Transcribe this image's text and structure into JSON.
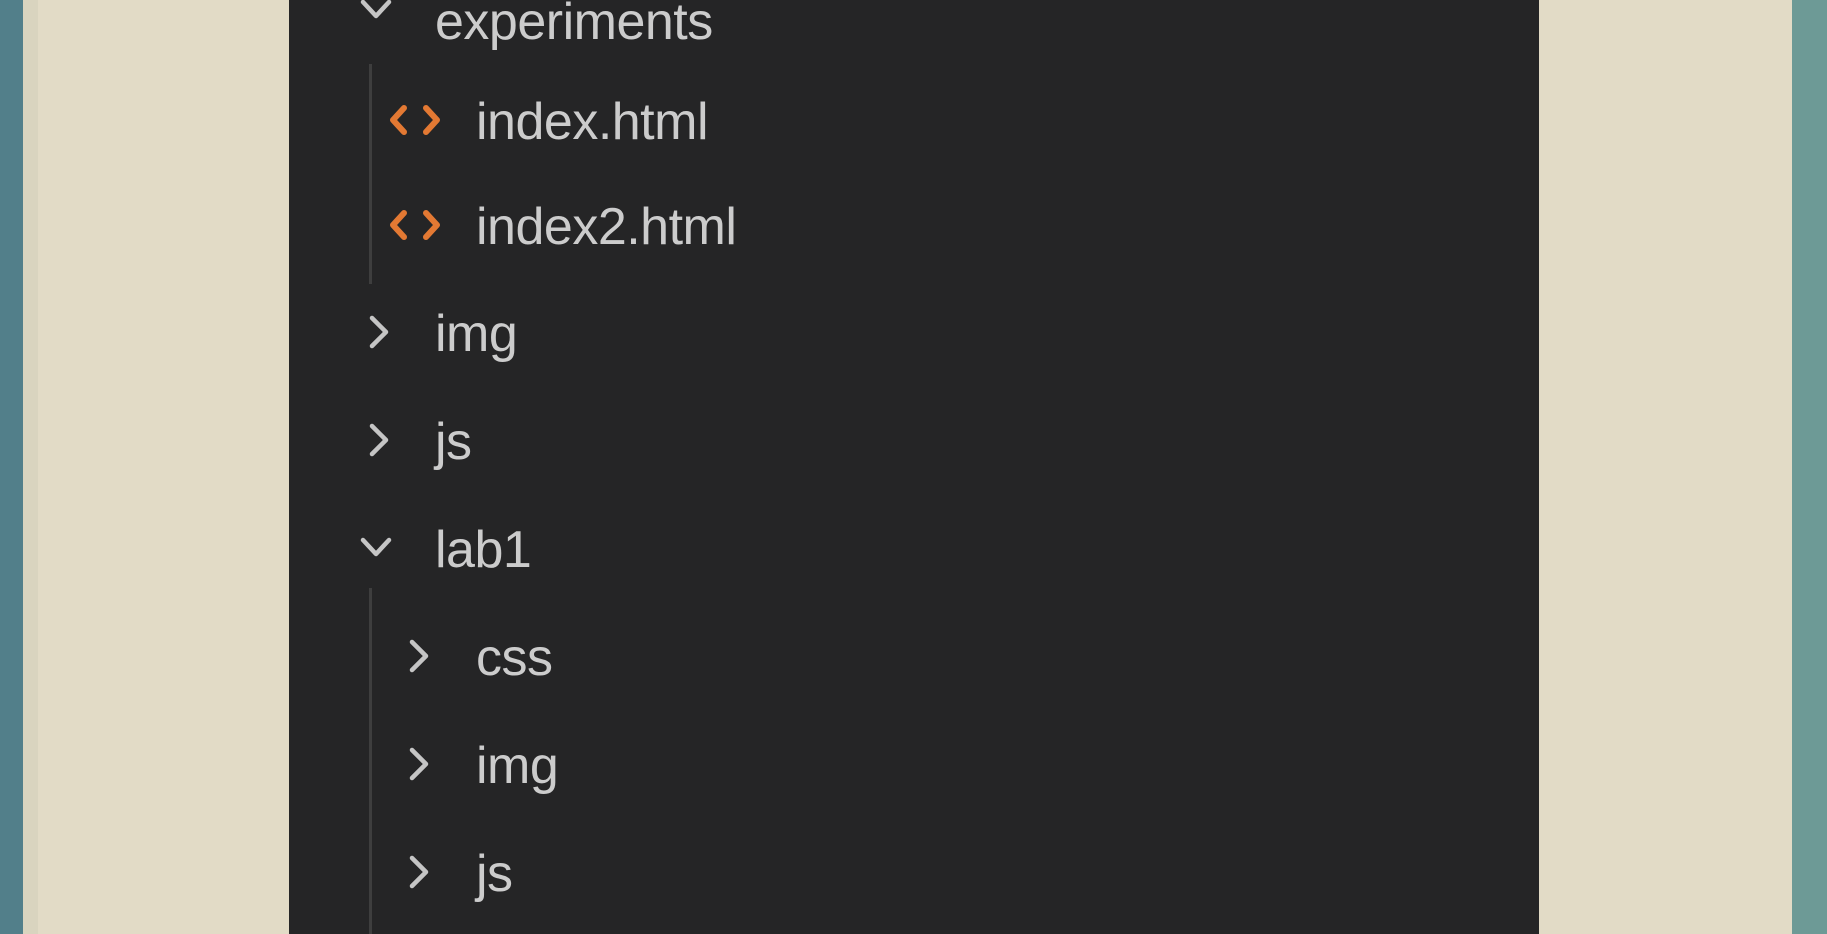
{
  "explorer": {
    "rows": [
      {
        "label": "experiments",
        "type": "folder",
        "expanded": true,
        "icon": "chevron-down-icon"
      },
      {
        "label": "index.html",
        "type": "file",
        "icon": "html-file-icon"
      },
      {
        "label": "index2.html",
        "type": "file",
        "icon": "html-file-icon"
      },
      {
        "label": "img",
        "type": "folder",
        "expanded": false,
        "icon": "chevron-right-icon"
      },
      {
        "label": "js",
        "type": "folder",
        "expanded": false,
        "icon": "chevron-right-icon"
      },
      {
        "label": "lab1",
        "type": "folder",
        "expanded": true,
        "icon": "chevron-down-icon"
      },
      {
        "label": "css",
        "type": "folder",
        "expanded": false,
        "icon": "chevron-right-icon"
      },
      {
        "label": "img",
        "type": "folder",
        "expanded": false,
        "icon": "chevron-right-icon"
      },
      {
        "label": "js",
        "type": "folder",
        "expanded": false,
        "icon": "chevron-right-icon"
      }
    ]
  },
  "colors": {
    "panel_background": "#252526",
    "label_text": "#cccccc",
    "chevron": "#c5c5c5",
    "html_icon": "#e37933",
    "backdrop": "#e2dbc6",
    "frame": "#5a858d"
  }
}
